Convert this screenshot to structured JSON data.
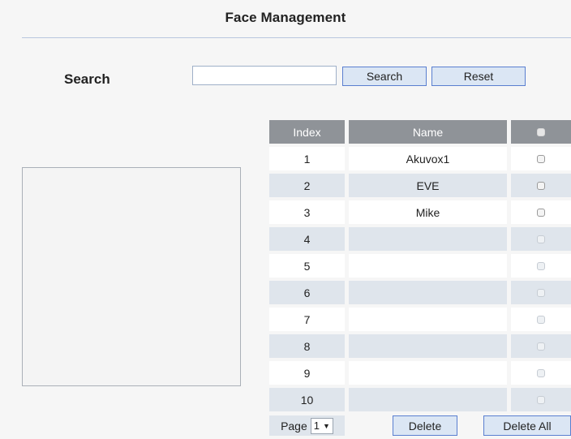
{
  "page": {
    "title": "Face Management"
  },
  "search": {
    "label": "Search",
    "input_value": "",
    "search_button": "Search",
    "reset_button": "Reset"
  },
  "table": {
    "headers": {
      "index": "Index",
      "name": "Name"
    },
    "rows": [
      {
        "index": "1",
        "name": "Akuvox1",
        "checked": false
      },
      {
        "index": "2",
        "name": "EVE",
        "checked": false
      },
      {
        "index": "3",
        "name": "Mike",
        "checked": false
      },
      {
        "index": "4",
        "name": "",
        "checked": false
      },
      {
        "index": "5",
        "name": "",
        "checked": false
      },
      {
        "index": "6",
        "name": "",
        "checked": false
      },
      {
        "index": "7",
        "name": "",
        "checked": false
      },
      {
        "index": "8",
        "name": "",
        "checked": false
      },
      {
        "index": "9",
        "name": "",
        "checked": false
      },
      {
        "index": "10",
        "name": "",
        "checked": false
      }
    ]
  },
  "footer": {
    "page_label": "Page",
    "page_value": "1",
    "delete_button": "Delete",
    "delete_all_button": "Delete All"
  },
  "colors": {
    "header_bg": "#8f9398",
    "row_alt_bg": "#dfe5ec",
    "button_bg": "#dbe6f4",
    "button_border": "#5a7fd0"
  },
  "icons": {
    "header_checkbox": "select-all-checkbox",
    "page_dropdown": "triangle-down-icon"
  }
}
